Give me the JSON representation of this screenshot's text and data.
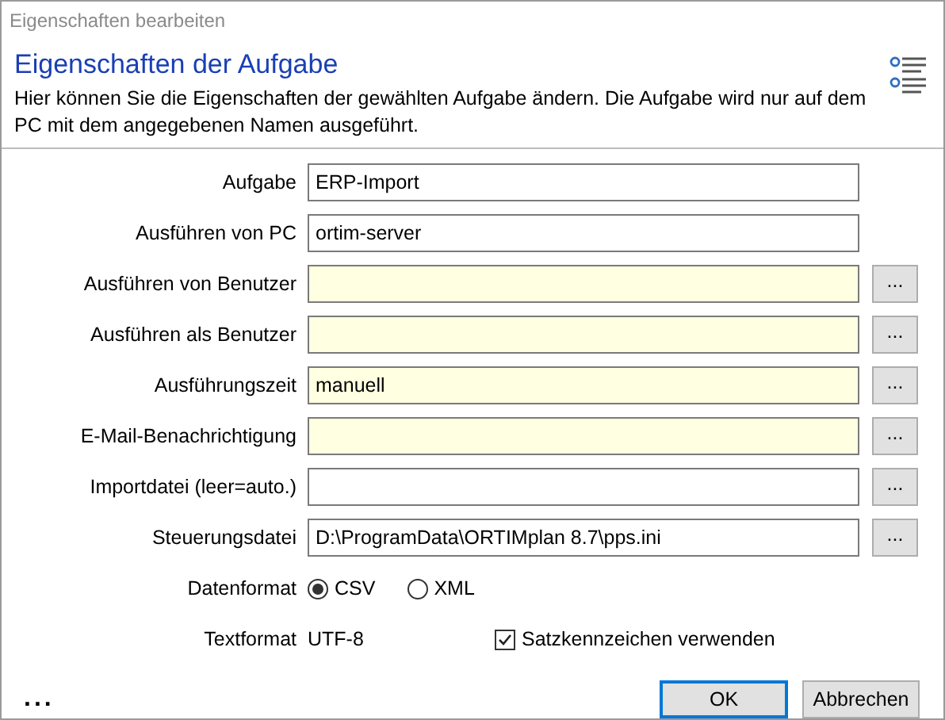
{
  "window": {
    "title": "Eigenschaften bearbeiten"
  },
  "header": {
    "title": "Eigenschaften der Aufgabe",
    "description": "Hier können Sie die Eigenschaften der gewählten Aufgabe ändern. Die Aufgabe wird nur auf dem PC mit dem angegebenen Namen ausgeführt."
  },
  "fields": [
    {
      "label": "Aufgabe",
      "value": "ERP-Import",
      "highlighted": false
    },
    {
      "label": "Ausführen von PC",
      "value": "ortim-server",
      "highlighted": false
    },
    {
      "label": "Ausführen von Benutzer",
      "highlighted": true,
      "browse": "..."
    },
    {
      "label": "Ausführen als Benutzer",
      "highlighted": true,
      "browse": "..."
    },
    {
      "label": "Ausführungszeit",
      "value": "manuell",
      "highlighted": true,
      "browse": "..."
    },
    {
      "label": "E-Mail-Benachrichtigung",
      "highlighted": true,
      "browse": "..."
    },
    {
      "label": "Importdatei (leer=auto.)",
      "highlighted": false,
      "browse": "..."
    },
    {
      "label": "Steuerungsdatei",
      "value": "D:\\ProgramData\\ORTIMplan 8.7\\pps.ini",
      "highlighted": false,
      "browse": "..."
    }
  ],
  "data_format": {
    "label": "Datenformat",
    "options": [
      {
        "label": "CSV",
        "selected": true
      },
      {
        "label": "XML",
        "selected": false
      }
    ]
  },
  "text_format": {
    "label": "Textformat",
    "value": "UTF-8"
  },
  "record_marker": {
    "label": "Satzkennzeichen verwenden",
    "checked": true
  },
  "more": "...",
  "buttons": [
    {
      "label": "OK",
      "default": true
    },
    {
      "label": "Abbrechen",
      "default": false
    }
  ]
}
